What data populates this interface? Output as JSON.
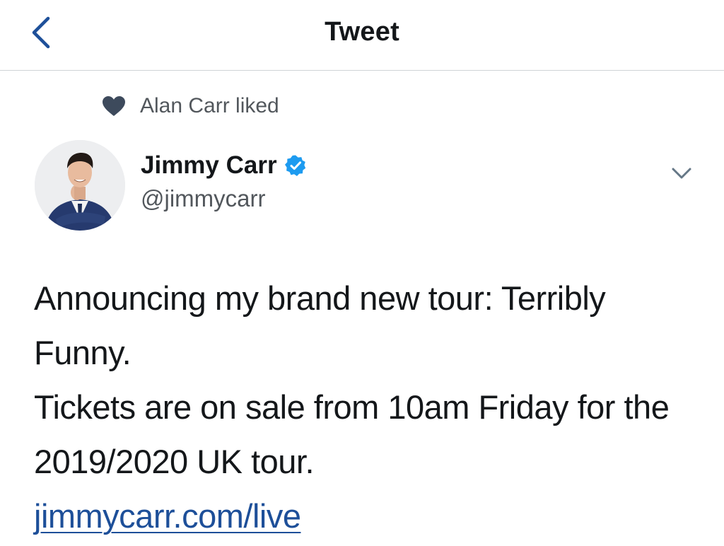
{
  "header": {
    "title": "Tweet",
    "back_icon": "chevron-left-icon"
  },
  "social_context": {
    "icon": "heart-icon",
    "text": "Alan Carr liked"
  },
  "author": {
    "name": "Jimmy Carr",
    "handle": "@jimmycarr",
    "verified": true,
    "verified_icon": "verified-badge-icon",
    "menu_icon": "chevron-down-icon"
  },
  "tweet": {
    "line1": "Announcing my brand new tour: Terribly Funny.",
    "line2": "Tickets are on sale from 10am Friday for the 2019/2020 UK tour.",
    "link_text": "jimmycarr.com/live"
  },
  "colors": {
    "accent": "#1d4f99",
    "verified_badge": "#1d9bf0",
    "text_primary": "#14171a",
    "text_secondary": "#52575c",
    "divider": "#cfd3d6"
  }
}
